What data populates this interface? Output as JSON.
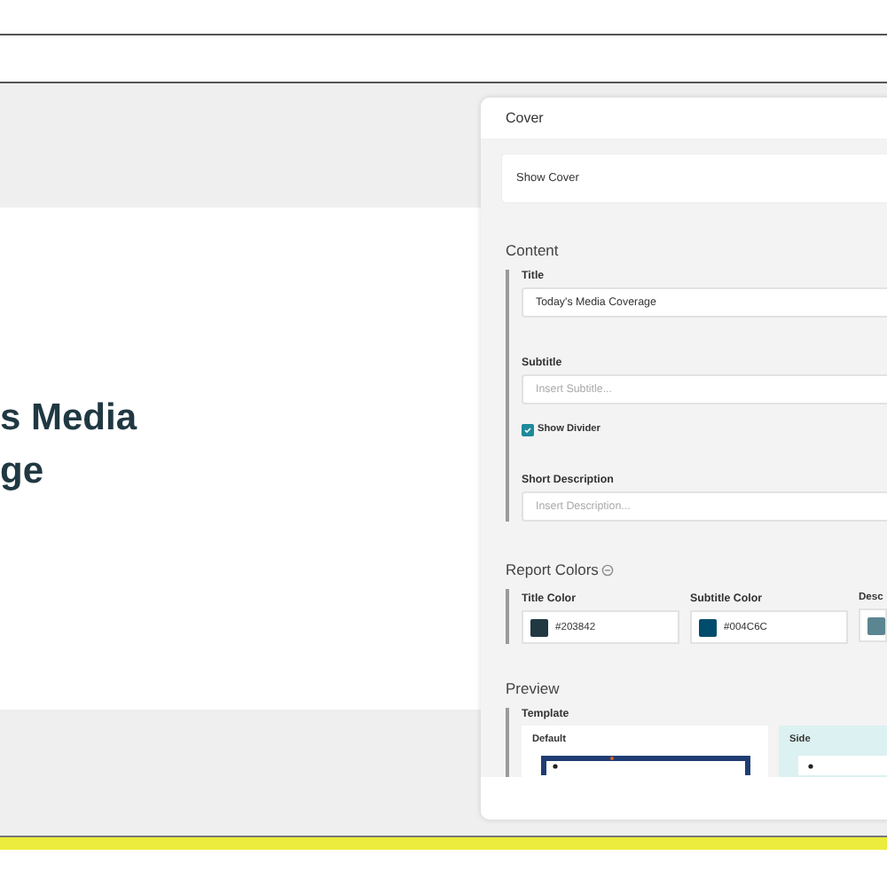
{
  "preview_title_lines": [
    "s Media",
    "ge"
  ],
  "panel": {
    "header": "Cover",
    "show_cover": {
      "label": "Show Cover"
    },
    "content": {
      "heading": "Content",
      "fields": [
        {
          "kind": "input",
          "label": "Title",
          "value": "Today's Media Coverage"
        },
        {
          "kind": "input",
          "label": "Subtitle",
          "placeholder": "Insert Subtitle..."
        },
        {
          "kind": "checkbox",
          "label": "Show Divider",
          "checked": true
        },
        {
          "kind": "input",
          "label": "Short Description",
          "placeholder": "Insert Description..."
        }
      ]
    },
    "report_colors": {
      "heading": "Report Colors",
      "items": [
        {
          "label": "Title Color",
          "color": "#203842",
          "value": "#203842"
        },
        {
          "label": "Subtitle Color",
          "color": "#004c6c",
          "value": "#004C6C"
        },
        {
          "label": "Desc",
          "color": "#5b8591"
        }
      ]
    },
    "preview": {
      "heading": "Preview",
      "label": "Template",
      "templates": [
        {
          "label": "Default",
          "selected": false
        },
        {
          "label": "Side",
          "selected": true
        }
      ]
    }
  }
}
